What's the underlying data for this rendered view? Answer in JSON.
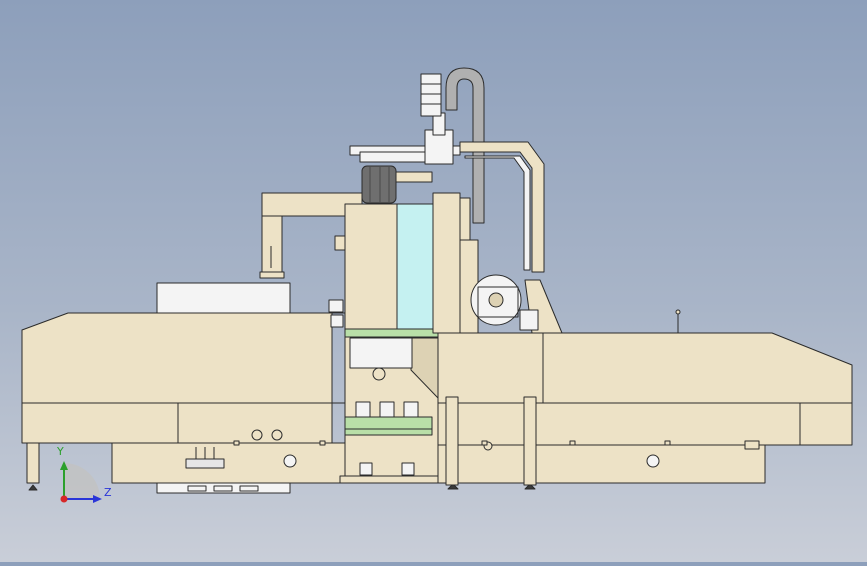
{
  "viewport": {
    "background_top": "#8d9fbb",
    "background_bottom": "#c9ced8"
  },
  "machine": {
    "body_color": "#ede2c6",
    "outline_color": "#2b2b2b",
    "accent_green": "#b9dfa8",
    "glass_cyan": "#c5f1f1",
    "panel_white": "#f4f4f4"
  },
  "triad": {
    "y_label": "Y",
    "z_label": "Z",
    "y_color": "#2ca02c",
    "z_color": "#2a35d8",
    "x_color": "#d62728"
  }
}
